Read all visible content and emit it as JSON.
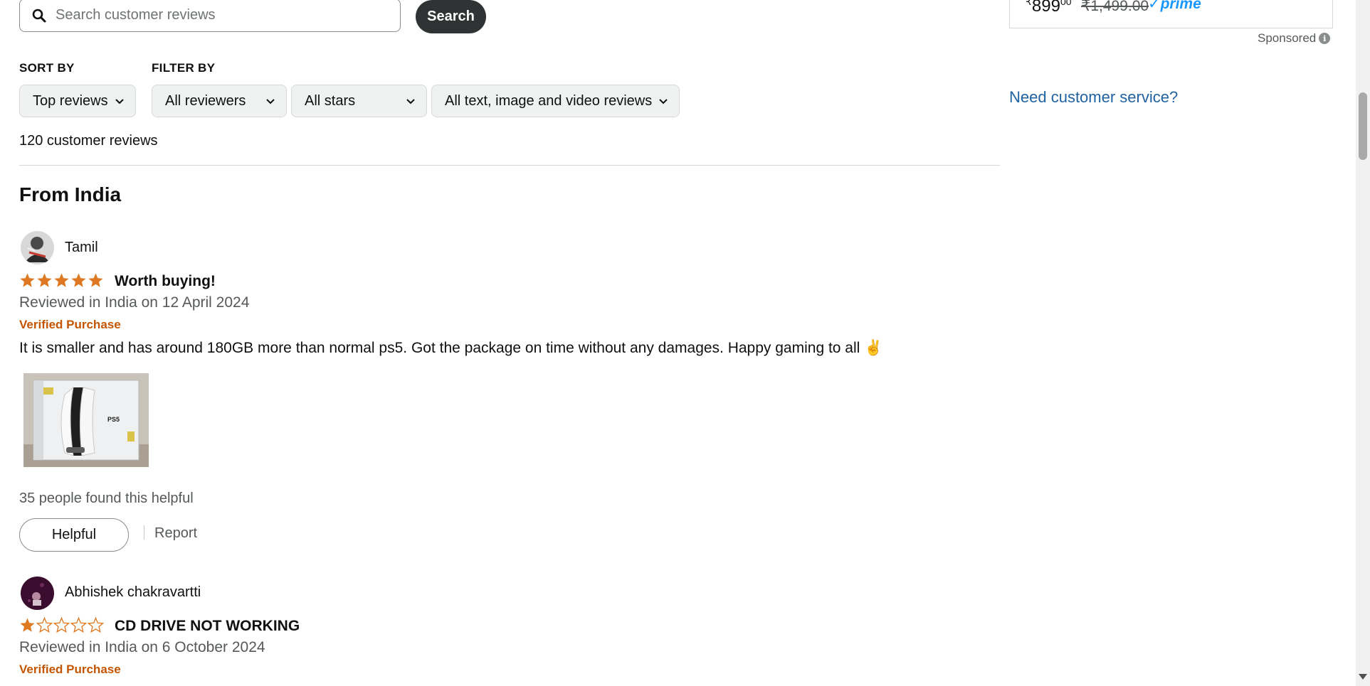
{
  "search": {
    "placeholder": "Search customer reviews",
    "button_label": "Search"
  },
  "sort": {
    "label": "SORT BY",
    "selected": "Top reviews"
  },
  "filter": {
    "label": "FILTER BY",
    "reviewers": "All reviewers",
    "stars": "All stars",
    "media": "All text, image and video reviews"
  },
  "reviews_count": "120 customer reviews",
  "section_heading": "From India",
  "reviews": [
    {
      "reviewer": "Tamil",
      "rating": 5,
      "title": "Worth buying!",
      "date": "Reviewed in India on 12 April 2024",
      "verified": "Verified Purchase",
      "body": "It is smaller and has around 180GB more than normal ps5. Got the package on time without any damages. Happy gaming to all ✌️",
      "helpful_count": "35 people found this helpful",
      "helpful_label": "Helpful",
      "report_label": "Report"
    },
    {
      "reviewer": "Abhishek chakravartti",
      "rating": 1,
      "title": "CD DRIVE NOT WORKING",
      "date": "Reviewed in India on 6 October 2024",
      "verified": "Verified Purchase"
    }
  ],
  "ad": {
    "price_symbol": "₹",
    "price_whole": "899",
    "price_fraction": "00",
    "old_price": "₹1,499.00",
    "prime_label": "✓prime",
    "sponsored_label": "Sponsored"
  },
  "customer_service_link": "Need customer service?",
  "colors": {
    "accent_orange": "#c45500",
    "star_color": "#de7921",
    "link_blue": "#2162a1",
    "dark_button": "#303333"
  }
}
